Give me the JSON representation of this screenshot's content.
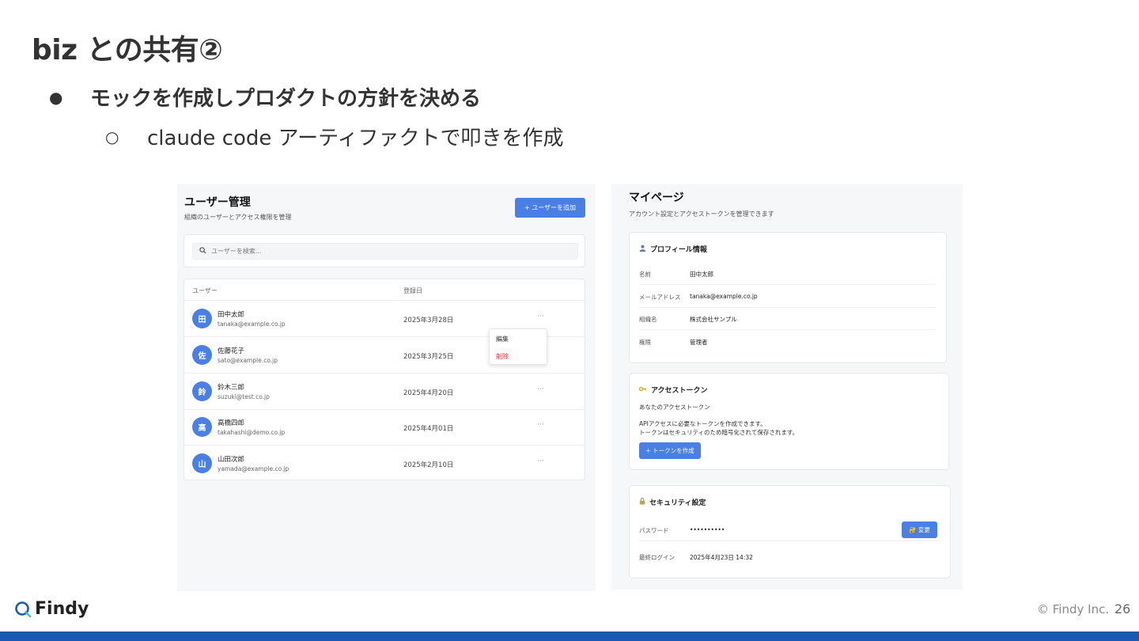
{
  "slide": {
    "title": "biz との共有②",
    "bullet1": {
      "marker": "●",
      "text": "モックを作成しプロダクトの方針を決める"
    },
    "bullet2": {
      "marker": "○",
      "text": "claude code アーティファクトで叩きを作成"
    }
  },
  "user_mgmt": {
    "title": "ユーザー管理",
    "subtitle": "組織のユーザーとアクセス権限を管理",
    "add_button": "+ ユーザーを追加",
    "search_placeholder": "ユーザーを検索...",
    "columns": [
      "ユーザー",
      "登録日"
    ],
    "rows": [
      {
        "initial": "田",
        "name": "田中太郎",
        "email": "tanaka@example.co.jp",
        "date": "2025年3月28日",
        "actions": "···"
      },
      {
        "initial": "佐",
        "name": "佐藤花子",
        "email": "sato@example.co.jp",
        "date": "2025年3月25日",
        "actions": ""
      },
      {
        "initial": "鈴",
        "name": "鈴木三郎",
        "email": "suzuki@test.co.jp",
        "date": "2025年4月20日",
        "actions": "···"
      },
      {
        "initial": "高",
        "name": "高橋四郎",
        "email": "takahashi@demo.co.jp",
        "date": "2025年4月01日",
        "actions": "···"
      },
      {
        "initial": "山",
        "name": "山田次郎",
        "email": "yamada@example.co.jp",
        "date": "2025年2月10日",
        "actions": "···"
      }
    ],
    "context_menu": {
      "edit": "編集",
      "delete": "削除"
    }
  },
  "mypage": {
    "title": "マイページ",
    "subtitle": "アカウント設定とアクセストークンを管理できます",
    "profile": {
      "title": "プロフィール情報",
      "fields": [
        {
          "label": "名前",
          "value": "田中太郎"
        },
        {
          "label": "メールアドレス",
          "value": "tanaka@example.co.jp"
        },
        {
          "label": "組織名",
          "value": "株式会社サンプル"
        },
        {
          "label": "権限",
          "value": "管理者"
        }
      ]
    },
    "token": {
      "title": "アクセストークン",
      "label": "あなたのアクセストークン",
      "desc1": "APIアクセスに必要なトークンを作成できます。",
      "desc2": "トークンはセキュリティのため暗号化されて保存されます。",
      "button": "+ トークンを作成"
    },
    "security": {
      "title": "セキュリティ設定",
      "password_label": "パスワード",
      "password_value": "••••••••••",
      "change_button": "🔐 変更",
      "last_login_label": "最終ログイン",
      "last_login_value": "2025年4月23日 14:32"
    }
  },
  "footer": {
    "logo_text": "Findy",
    "copyright": "© Findy Inc.",
    "page_number": "26"
  },
  "colors": {
    "accent": "#4a7fe3",
    "danger": "#d93030",
    "bottom_bar": "#1a5ab3"
  }
}
